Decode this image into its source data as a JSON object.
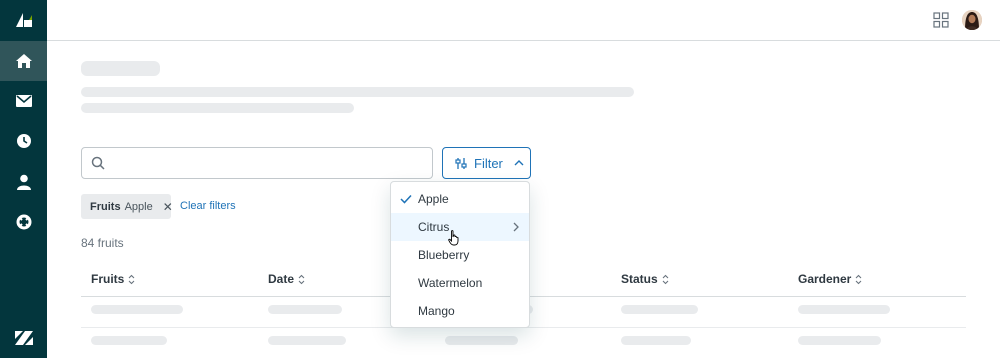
{
  "header": {
    "apps_icon": "grid-icon",
    "avatar": "user-avatar"
  },
  "sidebar": {
    "logo": "zendesk-product-logo",
    "items": [
      {
        "name": "home",
        "icon": "home-icon",
        "active": true
      },
      {
        "name": "mail",
        "icon": "mail-icon",
        "active": false
      },
      {
        "name": "history",
        "icon": "clock-icon",
        "active": false
      },
      {
        "name": "user",
        "icon": "user-icon",
        "active": false
      },
      {
        "name": "support",
        "icon": "lifebuoy-icon",
        "active": false
      }
    ],
    "bottom_logo": "zendesk-logo"
  },
  "search": {
    "placeholder": "",
    "value": ""
  },
  "filter": {
    "label": "Filter"
  },
  "chip": {
    "key": "Fruits",
    "value": "Apple"
  },
  "clear_filters": "Clear filters",
  "count": "84 fruits",
  "table": {
    "columns": [
      "Fruits",
      "Date",
      "",
      "Status",
      "Gardener"
    ]
  },
  "dropdown": {
    "options": [
      {
        "label": "Apple",
        "selected": true
      },
      {
        "label": "Citrus",
        "submenu": true,
        "hover": true
      },
      {
        "label": "Blueberry"
      },
      {
        "label": "Watermelon"
      },
      {
        "label": "Mango"
      }
    ]
  },
  "colors": {
    "sidebar": "#03363d",
    "accent": "#1f73b7",
    "skeleton": "#e9ebed"
  }
}
